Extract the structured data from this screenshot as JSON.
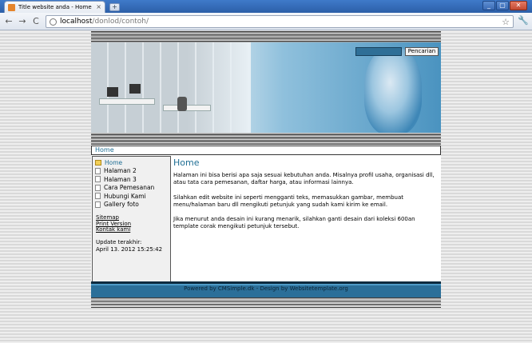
{
  "browser": {
    "tab_title": "Title website anda - Home",
    "tab_close": "×",
    "new_tab": "+",
    "url_host": "localhost",
    "url_path": "/donlod/contoh/",
    "star": "☆",
    "wrench": "🔧",
    "back": "←",
    "forward": "→",
    "reload": "C",
    "minimize": "_",
    "maximize": "▢",
    "close": "✕"
  },
  "header": {
    "search_placeholder": "",
    "search_button": "Pencarian"
  },
  "breadcrumb": "Home",
  "sidebar": {
    "menu": [
      {
        "label": "Home",
        "icon": "folder-icon"
      },
      {
        "label": "Halaman 2",
        "icon": "page-icon"
      },
      {
        "label": "Halaman 3",
        "icon": "page-icon"
      },
      {
        "label": "Cara Pemesanan",
        "icon": "page-icon"
      },
      {
        "label": "Hubungi Kami",
        "icon": "page-icon"
      },
      {
        "label": "Gallery foto",
        "icon": "page-icon"
      }
    ],
    "links": {
      "sitemap": "Sitemap",
      "print": "Print Version",
      "contact": "Kontak kami"
    },
    "updated_label": "Update terakhir:",
    "updated_value": "April 13. 2012 15:25:42"
  },
  "content": {
    "title": "Home",
    "paragraphs": [
      "Halaman ini bisa berisi apa saja sesuai kebutuhan anda. Misalnya profil usaha, organisasi dll, atau tata cara pemesanan, daftar harga, atau informasi lainnya.",
      "Silahkan edit website ini seperti mengganti teks, memasukkan gambar, membuat menu/halaman baru dll mengikuti petunjuk yang sudah kami kirim ke email.",
      "Jika menurut anda desain ini kurang menarik, silahkan ganti desain dari koleksi 600an template corak mengikuti petunjuk tersebut."
    ]
  },
  "footer": "Powered by CMSimple.dk - Design by Websitetemplate.org",
  "colors": {
    "link_blue": "#1f6e94",
    "footer_blue": "#2b6f99",
    "titlebar_blue": "#2c5fa8"
  }
}
